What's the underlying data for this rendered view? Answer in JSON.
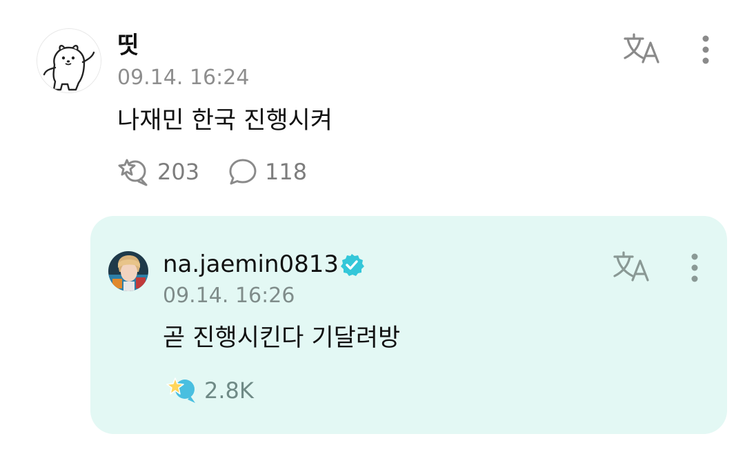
{
  "comment": {
    "username": "띳",
    "timestamp": "09.14. 16:24",
    "text": "나재민 한국 진행시켜",
    "like_count": "203",
    "reply_count": "118",
    "translate_icon": "translate-icon",
    "more_icon": "more-vertical-icon",
    "like_icon": "star-bubble-like-icon",
    "reply_icon": "speech-bubble-icon"
  },
  "reply": {
    "username": "na.jaemin0813",
    "verified_icon": "verified-badge-icon",
    "timestamp": "09.14. 16:26",
    "text": "곧 진행시킨다 기달려방",
    "like_count": "2.8K",
    "translate_icon": "translate-icon",
    "more_icon": "more-vertical-icon",
    "like_icon": "star-bubble-like-icon-filled"
  },
  "colors": {
    "reply_background": "#e3f8f4",
    "verified_badge": "#34c7d9",
    "icon_gray": "#8a8a8a",
    "timestamp_gray": "#8e8e8e"
  }
}
